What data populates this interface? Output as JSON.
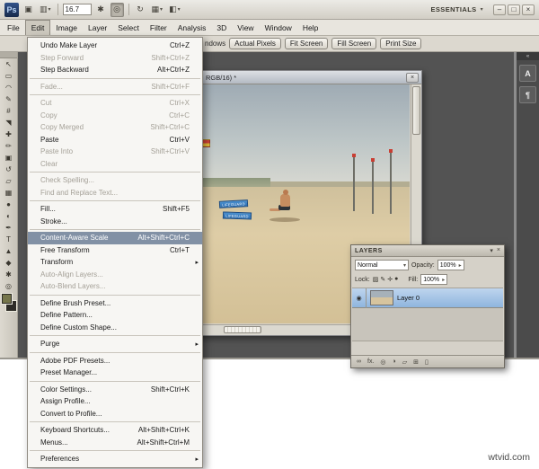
{
  "window": {
    "watermark": "wtvid.com"
  },
  "app_bar": {
    "logo": "Ps",
    "zoom_level": "16.7",
    "workspace": "ESSENTIALS",
    "icons": {
      "bridge": "▣",
      "view_extras": "▥",
      "hand": "✱",
      "zoom": "◎",
      "rotate": "↻",
      "arrange": "▦",
      "screen_mode": "◧",
      "dropdown": "▾"
    },
    "window_controls": {
      "minimize": "–",
      "maximize": "□",
      "close": "×"
    }
  },
  "menu_bar": {
    "items": [
      {
        "label": "File",
        "name": "menu-file"
      },
      {
        "label": "Edit",
        "name": "menu-edit",
        "state": "active"
      },
      {
        "label": "Image",
        "name": "menu-image"
      },
      {
        "label": "Layer",
        "name": "menu-layer"
      },
      {
        "label": "Select",
        "name": "menu-select"
      },
      {
        "label": "Filter",
        "name": "menu-filter"
      },
      {
        "label": "Analysis",
        "name": "menu-analysis"
      },
      {
        "label": "3D",
        "name": "menu-3d"
      },
      {
        "label": "View",
        "name": "menu-view"
      },
      {
        "label": "Window",
        "name": "menu-window"
      },
      {
        "label": "Help",
        "name": "menu-help"
      }
    ]
  },
  "options_bar": {
    "label_fragment": "ndows",
    "buttons": [
      {
        "label": "Actual Pixels",
        "name": "actual-pixels-button"
      },
      {
        "label": "Fit Screen",
        "name": "fit-screen-button"
      },
      {
        "label": "Fill Screen",
        "name": "fill-screen-button"
      },
      {
        "label": "Print Size",
        "name": "print-size-button"
      }
    ]
  },
  "toolbar": {
    "tools": [
      {
        "name": "move-tool",
        "glyph": "↖"
      },
      {
        "name": "marquee-tool",
        "glyph": "▭"
      },
      {
        "name": "lasso-tool",
        "glyph": "◠"
      },
      {
        "name": "quick-selection-tool",
        "glyph": "✎"
      },
      {
        "name": "crop-tool",
        "glyph": "#"
      },
      {
        "name": "eyedropper-tool",
        "glyph": "◥"
      },
      {
        "name": "healing-brush-tool",
        "glyph": "✚"
      },
      {
        "name": "brush-tool",
        "glyph": "✏"
      },
      {
        "name": "clone-stamp-tool",
        "glyph": "▣"
      },
      {
        "name": "history-brush-tool",
        "glyph": "↺"
      },
      {
        "name": "eraser-tool",
        "glyph": "▱"
      },
      {
        "name": "gradient-tool",
        "glyph": "▦"
      },
      {
        "name": "blur-tool",
        "glyph": "●"
      },
      {
        "name": "dodge-tool",
        "glyph": "◐"
      },
      {
        "name": "pen-tool",
        "glyph": "✒"
      },
      {
        "name": "type-tool",
        "glyph": "T"
      },
      {
        "name": "path-selection-tool",
        "glyph": "▲"
      },
      {
        "name": "shape-tool",
        "glyph": "◆"
      },
      {
        "name": "hand-tool",
        "glyph": "✱"
      },
      {
        "name": "zoom-tool",
        "glyph": "◎"
      }
    ],
    "foreground_style": "background:#76764b",
    "background_style": "background:#2e2c28"
  },
  "edit_menu": {
    "items": [
      {
        "label": "Undo Make Layer",
        "shortcut": "Ctrl+Z",
        "state": "normal"
      },
      {
        "label": "Step Forward",
        "shortcut": "Shift+Ctrl+Z",
        "state": "disabled"
      },
      {
        "label": "Step Backward",
        "shortcut": "Alt+Ctrl+Z",
        "state": "normal"
      },
      {
        "sep": true
      },
      {
        "label": "Fade...",
        "shortcut": "Shift+Ctrl+F",
        "state": "disabled"
      },
      {
        "sep": true
      },
      {
        "label": "Cut",
        "shortcut": "Ctrl+X",
        "state": "disabled"
      },
      {
        "label": "Copy",
        "shortcut": "Ctrl+C",
        "state": "disabled"
      },
      {
        "label": "Copy Merged",
        "shortcut": "Shift+Ctrl+C",
        "state": "disabled"
      },
      {
        "label": "Paste",
        "shortcut": "Ctrl+V",
        "state": "normal"
      },
      {
        "label": "Paste Into",
        "shortcut": "Shift+Ctrl+V",
        "state": "disabled"
      },
      {
        "label": "Clear",
        "shortcut": "",
        "state": "disabled"
      },
      {
        "sep": true
      },
      {
        "label": "Check Spelling...",
        "shortcut": "",
        "state": "disabled"
      },
      {
        "label": "Find and Replace Text...",
        "shortcut": "",
        "state": "disabled"
      },
      {
        "sep": true
      },
      {
        "label": "Fill...",
        "shortcut": "Shift+F5",
        "state": "normal"
      },
      {
        "label": "Stroke...",
        "shortcut": "",
        "state": "normal"
      },
      {
        "sep": true
      },
      {
        "label": "Content-Aware Scale",
        "shortcut": "Alt+Shift+Ctrl+C",
        "state": "highlighted"
      },
      {
        "label": "Free Transform",
        "shortcut": "Ctrl+T",
        "state": "normal"
      },
      {
        "label": "Transform",
        "shortcut": "",
        "state": "normal",
        "submenu": true
      },
      {
        "label": "Auto-Align Layers...",
        "shortcut": "",
        "state": "disabled"
      },
      {
        "label": "Auto-Blend Layers...",
        "shortcut": "",
        "state": "disabled"
      },
      {
        "sep": true
      },
      {
        "label": "Define Brush Preset...",
        "shortcut": "",
        "state": "normal"
      },
      {
        "label": "Define Pattern...",
        "shortcut": "",
        "state": "normal"
      },
      {
        "label": "Define Custom Shape...",
        "shortcut": "",
        "state": "normal"
      },
      {
        "sep": true
      },
      {
        "label": "Purge",
        "shortcut": "",
        "state": "normal",
        "submenu": true
      },
      {
        "sep": true
      },
      {
        "label": "Adobe PDF Presets...",
        "shortcut": "",
        "state": "normal"
      },
      {
        "label": "Preset Manager...",
        "shortcut": "",
        "state": "normal"
      },
      {
        "sep": true
      },
      {
        "label": "Color Settings...",
        "shortcut": "Shift+Ctrl+K",
        "state": "normal"
      },
      {
        "label": "Assign Profile...",
        "shortcut": "",
        "state": "normal"
      },
      {
        "label": "Convert to Profile...",
        "shortcut": "",
        "state": "normal"
      },
      {
        "sep": true
      },
      {
        "label": "Keyboard Shortcuts...",
        "shortcut": "Alt+Shift+Ctrl+K",
        "state": "normal"
      },
      {
        "label": "Menus...",
        "shortcut": "Alt+Shift+Ctrl+M",
        "state": "normal"
      },
      {
        "sep": true
      },
      {
        "label": "Preferences",
        "shortcut": "",
        "state": "normal",
        "submenu": true
      }
    ]
  },
  "document": {
    "title": "RGB/16) *",
    "close": "×",
    "signs": [
      "LIFEGUARD",
      "LIFEGUARD"
    ]
  },
  "layers_panel": {
    "title": "LAYERS",
    "collapse_icon": "▾",
    "close_icon": "×",
    "blend_mode": "Normal",
    "blend_arrow": "▾",
    "opacity_label": "Opacity:",
    "opacity_value": "100%",
    "value_arrow": "▸",
    "lock_label": "Lock:",
    "fill_label": "Fill:",
    "fill_value": "100%",
    "eye_icon": "◉",
    "lock_icons": [
      {
        "name": "lock-transparency-icon",
        "glyph": "▨"
      },
      {
        "name": "lock-image-icon",
        "glyph": "✎"
      },
      {
        "name": "lock-position-icon",
        "glyph": "✛"
      },
      {
        "name": "lock-all-icon",
        "glyph": "●"
      }
    ],
    "layers": [
      {
        "name": "Layer 0"
      }
    ],
    "footer_icons": [
      {
        "name": "link-layers-icon",
        "glyph": "∞"
      },
      {
        "name": "layer-style-icon",
        "glyph": "fx."
      },
      {
        "name": "layer-mask-icon",
        "glyph": "◎"
      },
      {
        "name": "adjustment-layer-icon",
        "glyph": "◑"
      },
      {
        "name": "layer-group-icon",
        "glyph": "▱"
      },
      {
        "name": "new-layer-icon",
        "glyph": "⊞"
      },
      {
        "name": "delete-layer-icon",
        "glyph": "▯"
      }
    ]
  },
  "right_dock": {
    "grip": "«",
    "panels": [
      {
        "name": "character-panel-button",
        "glyph": "A"
      },
      {
        "name": "paragraph-panel-button",
        "glyph": "¶"
      }
    ]
  }
}
